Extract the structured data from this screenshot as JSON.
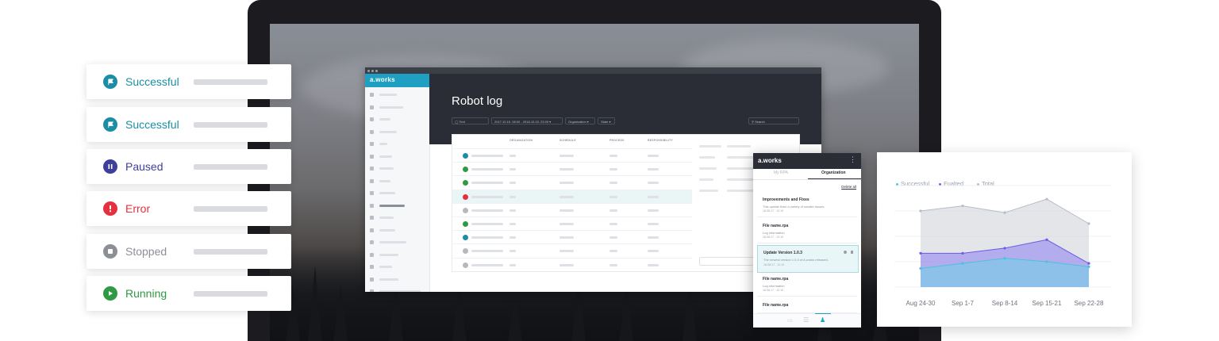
{
  "status_cards": [
    {
      "label": "Successful",
      "color": "#1b8ea5",
      "icon": "flag-icon"
    },
    {
      "label": "Successful",
      "color": "#1b8ea5",
      "icon": "flag-icon"
    },
    {
      "label": "Paused",
      "color": "#3d3f9a",
      "icon": "pause-icon"
    },
    {
      "label": "Error",
      "color": "#e5303f",
      "icon": "exclamation-icon"
    },
    {
      "label": "Stopped",
      "color": "#8c8f96",
      "icon": "stop-icon"
    },
    {
      "label": "Running",
      "color": "#2f9a42",
      "icon": "play-icon"
    }
  ],
  "app": {
    "logo": "a.works",
    "title": "Robot log",
    "filters": {
      "text": "Text",
      "date_range": "2017.10.15. 08:00 - 2018.10.15. 23:00 ▾",
      "organization": "Organization ▾",
      "state": "State ▾",
      "search_placeholder": "Search"
    },
    "columns": [
      "ORGANIZATION",
      "SCHEDULE",
      "PROCESS",
      "RESPONSIBILITY"
    ],
    "rows": [
      {
        "state": "success"
      },
      {
        "state": "running"
      },
      {
        "state": "running"
      },
      {
        "state": "error",
        "selected": true
      },
      {
        "state": "stopped"
      },
      {
        "state": "running"
      },
      {
        "state": "success"
      },
      {
        "state": "stopped"
      },
      {
        "state": "stopped"
      }
    ]
  },
  "mobile": {
    "logo": "a.works",
    "menu_icon": "⋮",
    "tabs": [
      "My RPA",
      "Organization"
    ],
    "active_tab": "Organization",
    "delete_all": "Delete all",
    "items": [
      {
        "title": "Improvements and Fixes",
        "subtitle": "This update fixes a variety of smaller issues.",
        "date": "18.08.17 · 12:10"
      },
      {
        "title": "File name.rpa",
        "subtitle": "Log information",
        "date": "18.08.17 · 12:10"
      },
      {
        "title": "Update Version 1.0.3",
        "subtitle": "The newest version 1.0.3 of A.works released.",
        "date": "18.08.17 · 12:10",
        "highlighted": true
      },
      {
        "title": "File name.rpa",
        "subtitle": "Log information",
        "date": "18.08.17 · 12:10"
      },
      {
        "title": "File name.rpa",
        "subtitle": "",
        "date": ""
      }
    ]
  },
  "chart_data": {
    "type": "area",
    "categories": [
      "Aug 24-30",
      "Sep 1-7",
      "Sep 8-14",
      "Sep 15-21",
      "Sep 22-28"
    ],
    "series": [
      {
        "name": "Successful",
        "color": "#4cc2de",
        "values": [
          22,
          28,
          34,
          30,
          24
        ]
      },
      {
        "name": "Fualted",
        "color": "#6b5be6",
        "values": [
          40,
          40,
          46,
          56,
          28
        ]
      },
      {
        "name": "Total",
        "color": "#b8bcc8",
        "values": [
          90,
          96,
          88,
          104,
          75
        ]
      }
    ],
    "ylim": [
      0,
      120
    ],
    "legend": "top-left",
    "grid": true
  }
}
